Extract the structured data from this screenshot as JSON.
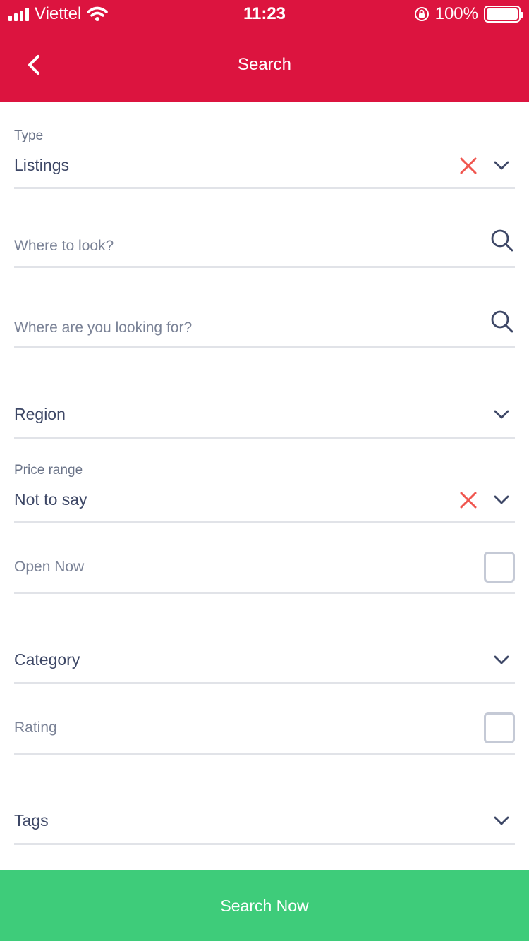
{
  "status_bar": {
    "carrier": "Viettel",
    "time": "11:23",
    "battery": "100%"
  },
  "header": {
    "title": "Search"
  },
  "form": {
    "type": {
      "label": "Type",
      "value": "Listings"
    },
    "where_to_look": {
      "placeholder": "Where to look?"
    },
    "looking_for": {
      "placeholder": "Where are you looking for?"
    },
    "region": {
      "label": "Region"
    },
    "price_range": {
      "label": "Price range",
      "value": "Not to say"
    },
    "open_now": {
      "label": "Open Now",
      "checked": false
    },
    "category": {
      "label": "Category"
    },
    "rating": {
      "label": "Rating",
      "checked": false
    },
    "tags": {
      "label": "Tags"
    }
  },
  "actions": {
    "search_now": "Search Now"
  },
  "colors": {
    "header": "#dc143f",
    "cta": "#3ecc7a",
    "clear_icon": "#f0564f",
    "divider": "#e1e3e8"
  }
}
